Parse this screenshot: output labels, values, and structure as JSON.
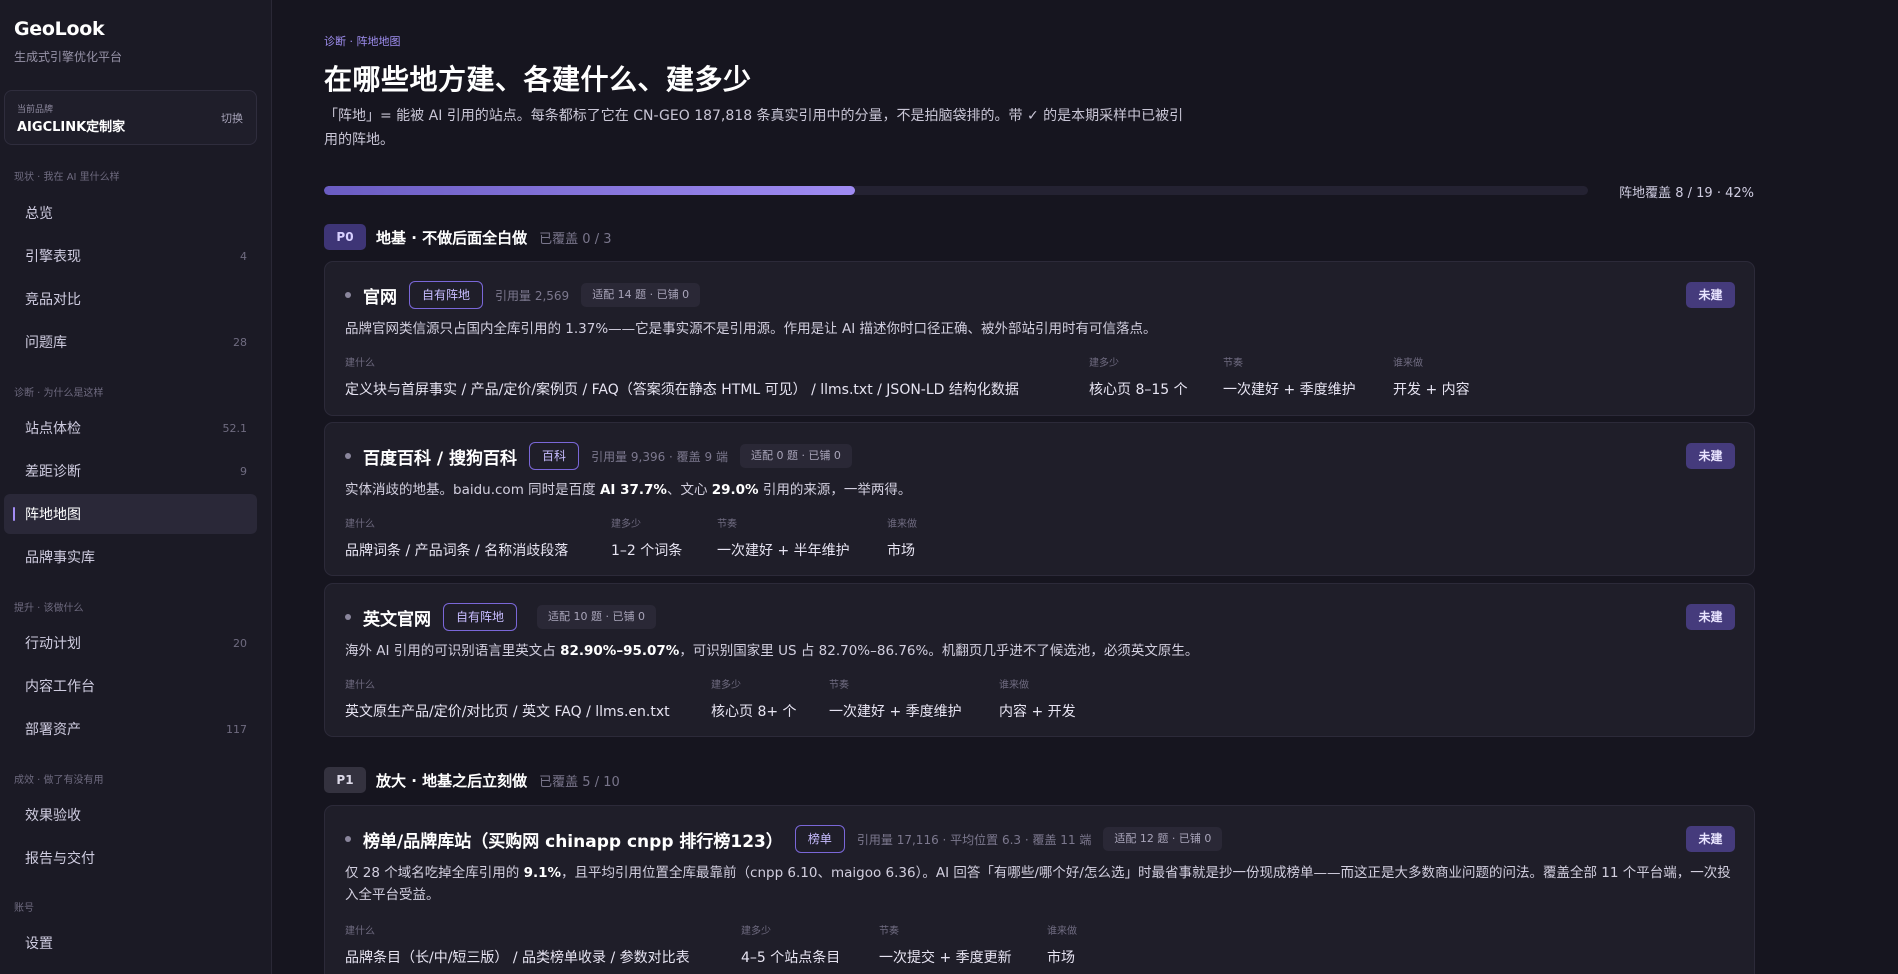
{
  "app": {
    "name": "GeoLook",
    "subtitle": "生成式引擎优化平台"
  },
  "brand_card": {
    "label": "当前品牌",
    "value": "AIGCLINK定制家",
    "switch": "切换"
  },
  "nav": {
    "s1": "现状 · 我在 AI 里什么样",
    "s2": "诊断 · 为什么是这样",
    "s3": "提升 · 该做什么",
    "s4": "成效 · 做了有没有用",
    "s5": "账号",
    "items": [
      {
        "label": "总览",
        "count": ""
      },
      {
        "label": "引擎表现",
        "count": "4"
      },
      {
        "label": "竞品对比",
        "count": ""
      },
      {
        "label": "问题库",
        "count": "28"
      },
      {
        "label": "站点体检",
        "count": "52.1"
      },
      {
        "label": "差距诊断",
        "count": "9"
      },
      {
        "label": "阵地地图",
        "count": ""
      },
      {
        "label": "品牌事实库",
        "count": ""
      },
      {
        "label": "行动计划",
        "count": "20"
      },
      {
        "label": "内容工作台",
        "count": ""
      },
      {
        "label": "部署资产",
        "count": "117"
      },
      {
        "label": "效果验收",
        "count": ""
      },
      {
        "label": "报告与交付",
        "count": ""
      },
      {
        "label": "设置",
        "count": ""
      }
    ]
  },
  "breadcrumb": "诊断 · 阵地地图",
  "page_title": "在哪些地方建、各建什么、建多少",
  "page_desc": "「阵地」= 能被 AI 引用的站点。每条都标了它在 CN-GEO 187,818 条真实引用中的分量，不是拍脑袋排的。带 ✓ 的是本期采样中已被引用的阵地。",
  "coverage": {
    "label": "阵地覆盖 8 / 19 · 42%",
    "fraction": 0.42
  },
  "groups": [
    {
      "badge": "P0",
      "title": "地基 · 不做后面全白做",
      "coverage": "已覆盖 0 / 3"
    },
    {
      "badge": "P1",
      "title": "放大 · 地基之后立刻做",
      "coverage": "已覆盖 5 / 10"
    }
  ],
  "col_labels": {
    "what": "建什么",
    "howmany": "建多少",
    "rhythm": "节奏",
    "who": "谁来做"
  },
  "cards": [
    {
      "name": "官网",
      "tag": "自有阵地",
      "meta": "引用量 2,569",
      "pill": "适配 14 题 · 已铺 0",
      "status": "未建",
      "desc": "品牌官网类信源只占国内全库引用的 1.37%——它是事实源不是引用源。作用是让 AI 描述你时口径正确、被外部站引用时有可信落点。",
      "what": "定义块与首屏事实 / 产品/定价/案例页 / FAQ（答案须在静态 HTML 可见） / llms.txt / JSON-LD 结构化数据",
      "howmany": "核心页 8–15 个",
      "rhythm": "一次建好 + 季度维护",
      "who": "开发 + 内容"
    },
    {
      "name": "百度百科 / 搜狗百科",
      "tag": "百科",
      "meta": "引用量 9,396 · 覆盖 9 端",
      "pill": "适配 0 题 · 已铺 0",
      "status": "未建",
      "desc_a": "实体消歧的地基。baidu.com 同时是百度 ",
      "desc_b1": "AI 37.7%",
      "desc_c": "、文心 ",
      "desc_b2": "29.0%",
      "desc_d": " 引用的来源，一举两得。",
      "what": "品牌词条 / 产品词条 / 名称消歧段落",
      "howmany": "1–2 个词条",
      "rhythm": "一次建好 + 半年维护",
      "who": "市场"
    },
    {
      "name": "英文官网",
      "tag": "自有阵地",
      "pill": "适配 10 题 · 已铺 0",
      "status": "未建",
      "desc_a": "海外 AI 引用的可识别语言里英文占 ",
      "desc_b1": "82.90%–95.07%",
      "desc_c": "，可识别国家里 US 占 82.70%–86.76%。机翻页几乎进不了候选池，必须英文原生。",
      "what": "英文原生产品/定价/对比页 / 英文 FAQ / llms.en.txt",
      "howmany": "核心页 8+ 个",
      "rhythm": "一次建好 + 季度维护",
      "who": "内容 + 开发"
    },
    {
      "name": "榜单/品牌库站（买购网 chinapp cnpp 排行榜123）",
      "tag": "榜单",
      "meta": "引用量 17,116 · 平均位置 6.3 · 覆盖 11 端",
      "pill": "适配 12 题 · 已铺 0",
      "status": "未建",
      "desc_a": "仅 28 个域名吃掉全库引用的 ",
      "desc_b1": "9.1%",
      "desc_c": "，且平均引用位置全库最靠前（cnpp 6.10、maigoo 6.36）。AI 回答「有哪些/哪个好/怎么选」时最省事就是抄一份现成榜单——而这正是大多数商业问题的问法。覆盖全部 11 个平台端，一次投入全平台受益。",
      "what": "品牌条目（长/中/短三版） / 品类榜单收录 / 参数对比表",
      "howmany": "4–5 个站点条目",
      "rhythm": "一次提交 + 季度更新",
      "who": "市场"
    }
  ]
}
